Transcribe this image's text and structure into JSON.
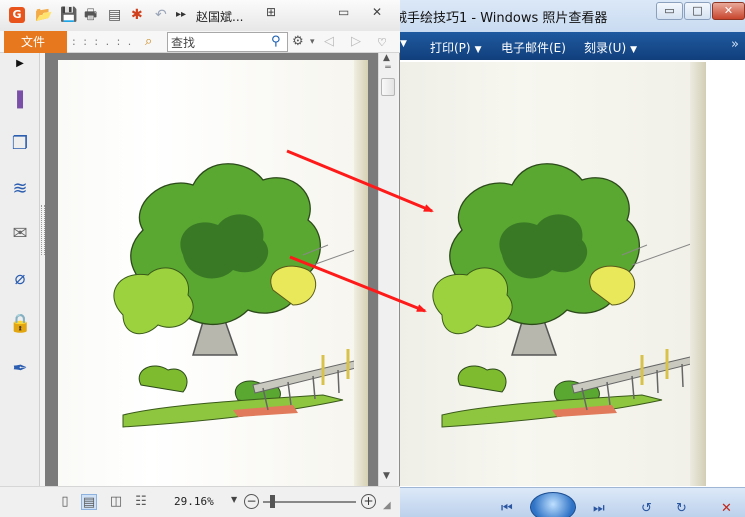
{
  "viewer": {
    "title": "绒手绘技巧1 - Windows 照片查看器",
    "min_glyph": "▭",
    "max_glyph": "□",
    "close_glyph": "✕",
    "menu": {
      "print": "打印(P)",
      "email": "电子邮件(E)",
      "burn": "刻录(U)",
      "caret": "▼",
      "more": "»"
    },
    "controls": {
      "prev": "⏮",
      "next": "⏭",
      "rotate_ccw": "↺",
      "rotate_cw": "↻",
      "delete": "✕"
    }
  },
  "reader": {
    "logo": "G",
    "title": "赵国斌...",
    "tile_glyph": "⊞",
    "min_glyph": "▭",
    "close_glyph": "✕",
    "quick_tools": {
      "open": "📂",
      "save": "💾",
      "print": "🖶",
      "properties": "▤",
      "new": "✱",
      "undo": "↶",
      "more": "▸▸"
    },
    "menu": {
      "file": "文件",
      "dotted": ": : : . : .",
      "search_placeholder": "查找",
      "settings": "⚙",
      "settings_caret": "▾",
      "back": "◁",
      "forward": "▷",
      "collapse": "♡"
    },
    "rail": {
      "expand": "▶",
      "bookmark": "❚",
      "pages": "❐",
      "layers": "≋",
      "comments": "✉",
      "attachments": "⌀",
      "security": "🔒",
      "signature": "✒"
    },
    "scroll": {
      "split": "═",
      "up": "▲",
      "down": "▼"
    },
    "status": {
      "single_page": "▯",
      "continuous": "▤",
      "facing": "◫",
      "continuous_facing": "☷",
      "zoom": "29.16%",
      "zoom_caret": "▼",
      "zoom_out": "−",
      "zoom_in": "+",
      "grip": "◢",
      "zoom_level": 0.1
    }
  },
  "colors": {
    "accent_orange": "#e8781e",
    "arrow_red": "#ff1a1a",
    "viewer_menubar": "#1f5aa0",
    "foliage_green": "#6bb43a"
  }
}
